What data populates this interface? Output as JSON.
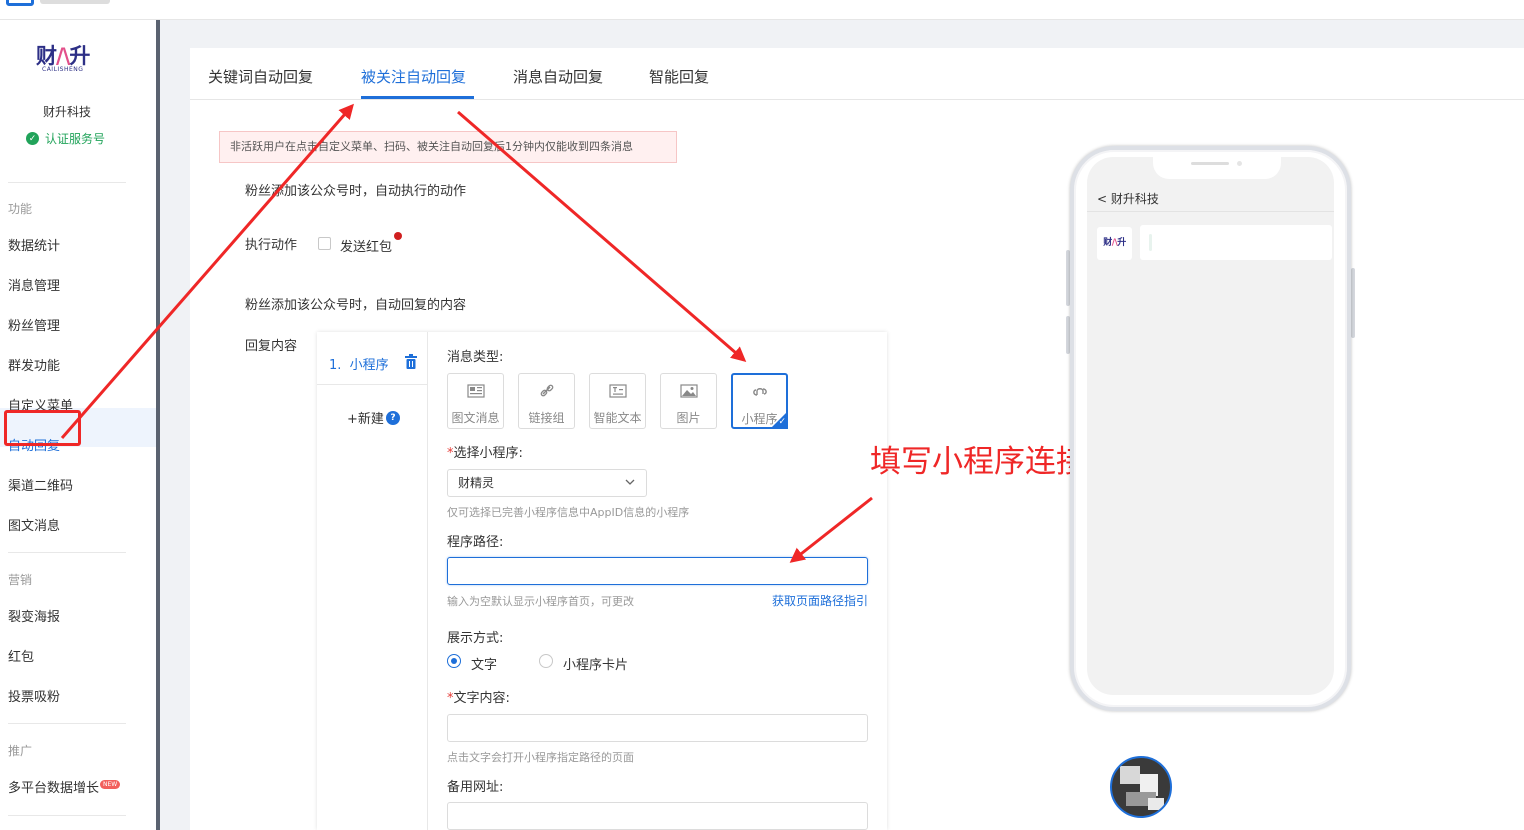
{
  "brand": {
    "logo_text_a": "财",
    "logo_text_b": "升",
    "logo_sub": "CAILISHENG",
    "name": "财升科技",
    "verified": "认证服务号"
  },
  "sidebar": {
    "section_func": "功能",
    "items_func": [
      "数据统计",
      "消息管理",
      "粉丝管理",
      "群发功能",
      "自定义菜单",
      "自动回复",
      "渠道二维码",
      "图文消息"
    ],
    "section_market": "营销",
    "items_market": [
      "裂变海报",
      "红包",
      "投票吸粉"
    ],
    "section_promo": "推广",
    "items_promo": [
      "多平台数据增长"
    ],
    "new_badge": "NEW"
  },
  "tabs": [
    "关键词自动回复",
    "被关注自动回复",
    "消息自动回复",
    "智能回复"
  ],
  "form": {
    "notice": "非活跃用户在点击自定义菜单、扫码、被关注自动回复后1分钟内仅能收到四条消息",
    "action_intro": "粉丝添加该公众号时，自动执行的动作",
    "action_label": "执行动作",
    "redpack_label": "发送红包",
    "reply_intro": "粉丝添加该公众号时，自动回复的内容",
    "reply_label": "回复内容"
  },
  "editor": {
    "left_item_index": "1.",
    "left_item_label": "小程序",
    "new_label": "+新建",
    "q_mark": "?",
    "msg_type_label": "消息类型:",
    "msg_types": [
      "图文消息",
      "链接组",
      "智能文本",
      "图片",
      "小程序"
    ],
    "select_mp_label": "选择小程序:",
    "select_mp_value": "财精灵",
    "select_mp_hint": "仅可选择已完善小程序信息中AppID信息的小程序",
    "path_label": "程序路径:",
    "path_value": "",
    "path_hint": "输入为空默认显示小程序首页，可更改",
    "path_link": "获取页面路径指引",
    "display_label": "展示方式:",
    "display_options": [
      "文字",
      "小程序卡片"
    ],
    "text_label": "文字内容:",
    "text_hint": "点击文字会打开小程序指定路径的页面",
    "backup_label": "备用网址:"
  },
  "annotation": "填写小程序连接",
  "phone": {
    "back": "<",
    "title": "财升科技"
  },
  "colors": {
    "accent": "#1e6fd9",
    "annotation_red": "#ef2727",
    "verified_green": "#21a35a"
  }
}
